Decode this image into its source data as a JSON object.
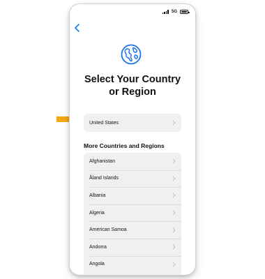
{
  "status_bar": {
    "network": "5G"
  },
  "header": {
    "icon": "globe-icon",
    "title": "Select Your Country\nor Region"
  },
  "selected_country": {
    "label": "United States"
  },
  "section": {
    "title": "More Countries and Regions"
  },
  "countries": [
    "Afghanistan",
    "Åland Islands",
    "Albania",
    "Algeria",
    "American Samoa",
    "Andorra",
    "Angola"
  ],
  "colors": {
    "accent": "#1a73e8",
    "row_background": "#f0f0f3",
    "annotation_arrow": "#f5a614"
  }
}
